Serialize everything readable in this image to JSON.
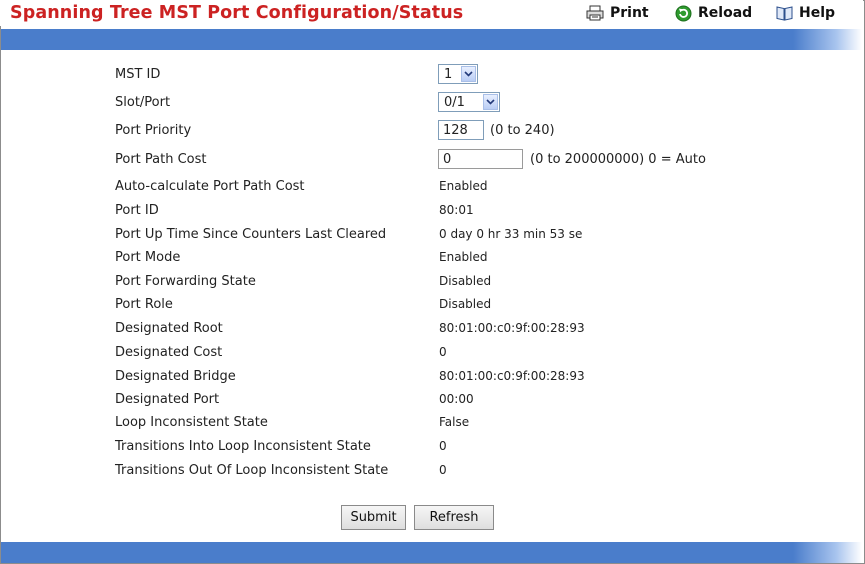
{
  "header": {
    "title": "Spanning Tree MST Port Configuration/Status",
    "print_label": "Print",
    "reload_label": "Reload",
    "help_label": "Help"
  },
  "form": {
    "mst_id": {
      "label": "MST ID",
      "value": "1"
    },
    "slot_port": {
      "label": "Slot/Port",
      "value": "0/1"
    },
    "port_priority": {
      "label": "Port Priority",
      "value": "128",
      "range": "(0 to 240)"
    },
    "port_path_cost": {
      "label": "Port Path Cost",
      "value": "0",
      "range": "(0 to 200000000) 0 = Auto"
    }
  },
  "status_rows": [
    {
      "label": "Auto-calculate Port Path Cost",
      "value": "Enabled"
    },
    {
      "label": "Port ID",
      "value": "80:01"
    },
    {
      "label": "Port Up Time Since Counters Last Cleared",
      "value": "0 day 0 hr 33 min 53 se"
    },
    {
      "label": "Port Mode",
      "value": "Enabled"
    },
    {
      "label": "Port Forwarding State",
      "value": "Disabled"
    },
    {
      "label": "Port Role",
      "value": "Disabled"
    },
    {
      "label": "Designated Root",
      "value": "80:01:00:c0:9f:00:28:93"
    },
    {
      "label": "Designated Cost",
      "value": "0"
    },
    {
      "label": "Designated Bridge",
      "value": "80:01:00:c0:9f:00:28:93"
    },
    {
      "label": "Designated Port",
      "value": "00:00"
    },
    {
      "label": "Loop Inconsistent State",
      "value": "False"
    },
    {
      "label": "Transitions Into Loop Inconsistent State",
      "value": "0"
    },
    {
      "label": "Transitions Out Of Loop Inconsistent State",
      "value": "0"
    }
  ],
  "actions": {
    "submit_label": "Submit",
    "refresh_label": "Refresh"
  },
  "colors": {
    "title": "#cc2222",
    "band": "#4a7dcb"
  }
}
